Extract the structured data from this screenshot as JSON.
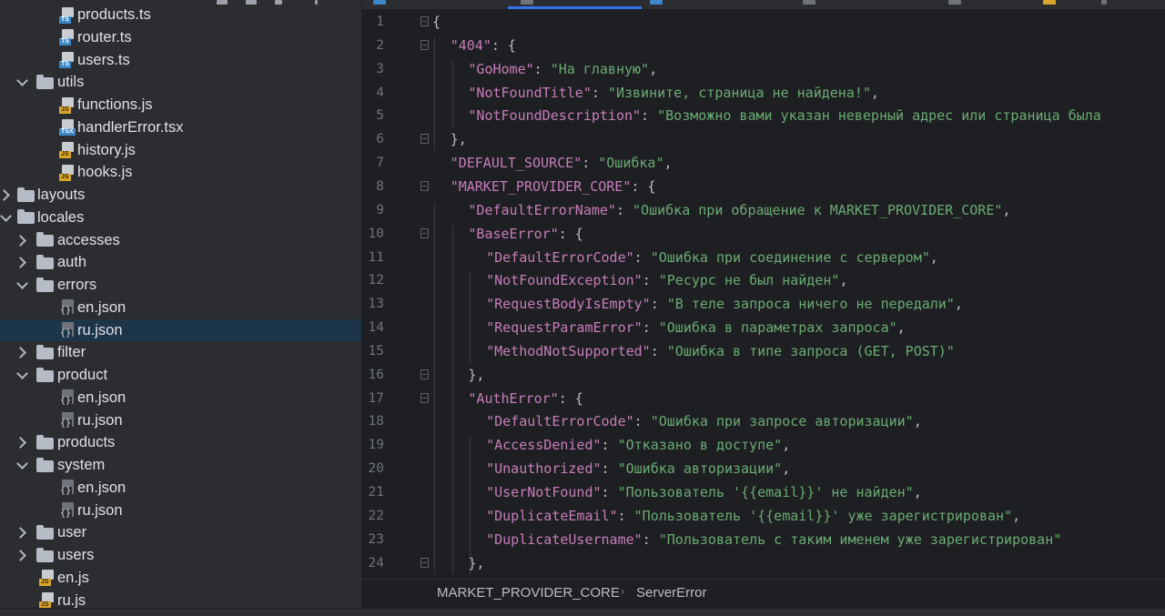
{
  "project_tree": [
    {
      "label": "products.ts",
      "kind": "file",
      "lang": "TS",
      "depth": 3
    },
    {
      "label": "router.ts",
      "kind": "file",
      "lang": "TS",
      "depth": 3
    },
    {
      "label": "users.ts",
      "kind": "file",
      "lang": "TS",
      "depth": 3
    },
    {
      "label": "utils",
      "kind": "folder",
      "expanded": true,
      "depth": 2
    },
    {
      "label": "functions.js",
      "kind": "file",
      "lang": "JS",
      "depth": 3
    },
    {
      "label": "handlerError.tsx",
      "kind": "file",
      "lang": "TSX",
      "depth": 3
    },
    {
      "label": "history.js",
      "kind": "file",
      "lang": "JS",
      "depth": 3
    },
    {
      "label": "hooks.js",
      "kind": "file",
      "lang": "JS",
      "depth": 3
    },
    {
      "label": "layouts",
      "kind": "folder",
      "expanded": false,
      "depth": 1
    },
    {
      "label": "locales",
      "kind": "folder",
      "expanded": true,
      "depth": 1
    },
    {
      "label": "accesses",
      "kind": "folder",
      "expanded": false,
      "depth": 2
    },
    {
      "label": "auth",
      "kind": "folder",
      "expanded": false,
      "depth": 2
    },
    {
      "label": "errors",
      "kind": "folder",
      "expanded": true,
      "depth": 2
    },
    {
      "label": "en.json",
      "kind": "json",
      "depth": 3
    },
    {
      "label": "ru.json",
      "kind": "json",
      "depth": 3,
      "selected": true
    },
    {
      "label": "filter",
      "kind": "folder",
      "expanded": false,
      "depth": 2
    },
    {
      "label": "product",
      "kind": "folder",
      "expanded": true,
      "depth": 2
    },
    {
      "label": "en.json",
      "kind": "json",
      "depth": 3
    },
    {
      "label": "ru.json",
      "kind": "json",
      "depth": 3
    },
    {
      "label": "products",
      "kind": "folder",
      "expanded": false,
      "depth": 2
    },
    {
      "label": "system",
      "kind": "folder",
      "expanded": true,
      "depth": 2
    },
    {
      "label": "en.json",
      "kind": "json",
      "depth": 3
    },
    {
      "label": "ru.json",
      "kind": "json",
      "depth": 3
    },
    {
      "label": "user",
      "kind": "folder",
      "expanded": false,
      "depth": 2
    },
    {
      "label": "users",
      "kind": "folder",
      "expanded": false,
      "depth": 2
    },
    {
      "label": "en.js",
      "kind": "file",
      "lang": "JS",
      "depth": 2
    },
    {
      "label": "ru.js",
      "kind": "file",
      "lang": "JS",
      "depth": 2
    }
  ],
  "editor": {
    "lines": [
      {
        "n": "1",
        "indent": 0,
        "fold": true,
        "tokens": [
          {
            "t": "p",
            "v": "{"
          }
        ]
      },
      {
        "n": "2",
        "indent": 1,
        "fold": true,
        "tokens": [
          {
            "t": "k",
            "v": "\"404\""
          },
          {
            "t": "p",
            "v": ": {"
          }
        ]
      },
      {
        "n": "3",
        "indent": 2,
        "tokens": [
          {
            "t": "k",
            "v": "\"GoHome\""
          },
          {
            "t": "p",
            "v": ": "
          },
          {
            "t": "s",
            "v": "\"На главную\""
          },
          {
            "t": "p",
            "v": ","
          }
        ]
      },
      {
        "n": "4",
        "indent": 2,
        "tokens": [
          {
            "t": "k",
            "v": "\"NotFoundTitle\""
          },
          {
            "t": "p",
            "v": ": "
          },
          {
            "t": "s",
            "v": "\"Извините, страница не найдена!\""
          },
          {
            "t": "p",
            "v": ","
          }
        ]
      },
      {
        "n": "5",
        "indent": 2,
        "tokens": [
          {
            "t": "k",
            "v": "\"NotFoundDescription\""
          },
          {
            "t": "p",
            "v": ": "
          },
          {
            "t": "s",
            "v": "\"Возможно вами указан неверный адрес или страница была"
          }
        ]
      },
      {
        "n": "6",
        "indent": 1,
        "fold": true,
        "tokens": [
          {
            "t": "p",
            "v": "},"
          }
        ]
      },
      {
        "n": "7",
        "indent": 1,
        "tokens": [
          {
            "t": "k",
            "v": "\"DEFAULT_SOURCE\""
          },
          {
            "t": "p",
            "v": ": "
          },
          {
            "t": "s",
            "v": "\"Ошибка\""
          },
          {
            "t": "p",
            "v": ","
          }
        ]
      },
      {
        "n": "8",
        "indent": 1,
        "fold": true,
        "tokens": [
          {
            "t": "k",
            "v": "\"MARKET_PROVIDER_CORE\""
          },
          {
            "t": "p",
            "v": ": {"
          }
        ]
      },
      {
        "n": "9",
        "indent": 2,
        "tokens": [
          {
            "t": "k",
            "v": "\"DefaultErrorName\""
          },
          {
            "t": "p",
            "v": ": "
          },
          {
            "t": "s",
            "v": "\"Ошибка при обращение к MARKET_PROVIDER_CORE\""
          },
          {
            "t": "p",
            "v": ","
          }
        ]
      },
      {
        "n": "10",
        "indent": 2,
        "fold": true,
        "tokens": [
          {
            "t": "k",
            "v": "\"BaseError\""
          },
          {
            "t": "p",
            "v": ": {"
          }
        ]
      },
      {
        "n": "11",
        "indent": 3,
        "tokens": [
          {
            "t": "k",
            "v": "\"DefaultErrorCode\""
          },
          {
            "t": "p",
            "v": ": "
          },
          {
            "t": "s",
            "v": "\"Ошибка при соединение с сервером\""
          },
          {
            "t": "p",
            "v": ","
          }
        ]
      },
      {
        "n": "12",
        "indent": 3,
        "tokens": [
          {
            "t": "k",
            "v": "\"NotFoundException\""
          },
          {
            "t": "p",
            "v": ": "
          },
          {
            "t": "s",
            "v": "\"Ресурс не был найден\""
          },
          {
            "t": "p",
            "v": ","
          }
        ]
      },
      {
        "n": "13",
        "indent": 3,
        "tokens": [
          {
            "t": "k",
            "v": "\"RequestBodyIsEmpty\""
          },
          {
            "t": "p",
            "v": ": "
          },
          {
            "t": "s",
            "v": "\"В теле запроса ничего не передали\""
          },
          {
            "t": "p",
            "v": ","
          }
        ]
      },
      {
        "n": "14",
        "indent": 3,
        "tokens": [
          {
            "t": "k",
            "v": "\"RequestParamError\""
          },
          {
            "t": "p",
            "v": ": "
          },
          {
            "t": "s",
            "v": "\"Ошибка в параметрах запроса\""
          },
          {
            "t": "p",
            "v": ","
          }
        ]
      },
      {
        "n": "15",
        "indent": 3,
        "tokens": [
          {
            "t": "k",
            "v": "\"MethodNotSupported\""
          },
          {
            "t": "p",
            "v": ": "
          },
          {
            "t": "s",
            "v": "\"Ошибка в типе запроса (GET, POST)\""
          }
        ]
      },
      {
        "n": "16",
        "indent": 2,
        "fold": true,
        "tokens": [
          {
            "t": "p",
            "v": "},"
          }
        ]
      },
      {
        "n": "17",
        "indent": 2,
        "fold": true,
        "tokens": [
          {
            "t": "k",
            "v": "\"AuthError\""
          },
          {
            "t": "p",
            "v": ": {"
          }
        ]
      },
      {
        "n": "18",
        "indent": 3,
        "tokens": [
          {
            "t": "k",
            "v": "\"DefaultErrorCode\""
          },
          {
            "t": "p",
            "v": ": "
          },
          {
            "t": "s",
            "v": "\"Ошибка при запросе авторизации\""
          },
          {
            "t": "p",
            "v": ","
          }
        ]
      },
      {
        "n": "19",
        "indent": 3,
        "tokens": [
          {
            "t": "k",
            "v": "\"AccessDenied\""
          },
          {
            "t": "p",
            "v": ": "
          },
          {
            "t": "s",
            "v": "\"Отказано в доступе\""
          },
          {
            "t": "p",
            "v": ","
          }
        ]
      },
      {
        "n": "20",
        "indent": 3,
        "tokens": [
          {
            "t": "k",
            "v": "\"Unauthorized\""
          },
          {
            "t": "p",
            "v": ": "
          },
          {
            "t": "s",
            "v": "\"Ошибка авторизации\""
          },
          {
            "t": "p",
            "v": ","
          }
        ]
      },
      {
        "n": "21",
        "indent": 3,
        "tokens": [
          {
            "t": "k",
            "v": "\"UserNotFound\""
          },
          {
            "t": "p",
            "v": ": "
          },
          {
            "t": "s",
            "v": "\"Пользователь '{{email}}' не найден\""
          },
          {
            "t": "p",
            "v": ","
          }
        ]
      },
      {
        "n": "22",
        "indent": 3,
        "tokens": [
          {
            "t": "k",
            "v": "\"DuplicateEmail\""
          },
          {
            "t": "p",
            "v": ": "
          },
          {
            "t": "s",
            "v": "\"Пользователь '{{email}}' уже зарегистрирован\""
          },
          {
            "t": "p",
            "v": ","
          }
        ]
      },
      {
        "n": "23",
        "indent": 3,
        "tokens": [
          {
            "t": "k",
            "v": "\"DuplicateUsername\""
          },
          {
            "t": "p",
            "v": ": "
          },
          {
            "t": "s",
            "v": "\"Пользователь с таким именем уже зарегистрирован\""
          }
        ]
      },
      {
        "n": "24",
        "indent": 2,
        "fold": true,
        "tokens": [
          {
            "t": "p",
            "v": "},"
          }
        ]
      }
    ]
  },
  "breadcrumbs": {
    "first": "MARKET_PROVIDER_CORE",
    "separator": "›",
    "second": "ServerError"
  },
  "colors": {
    "key": "#c77dbb",
    "string": "#6aab73",
    "punctuation": "#bcbec4",
    "selection": "#1d3549",
    "accent": "#3574f0"
  }
}
